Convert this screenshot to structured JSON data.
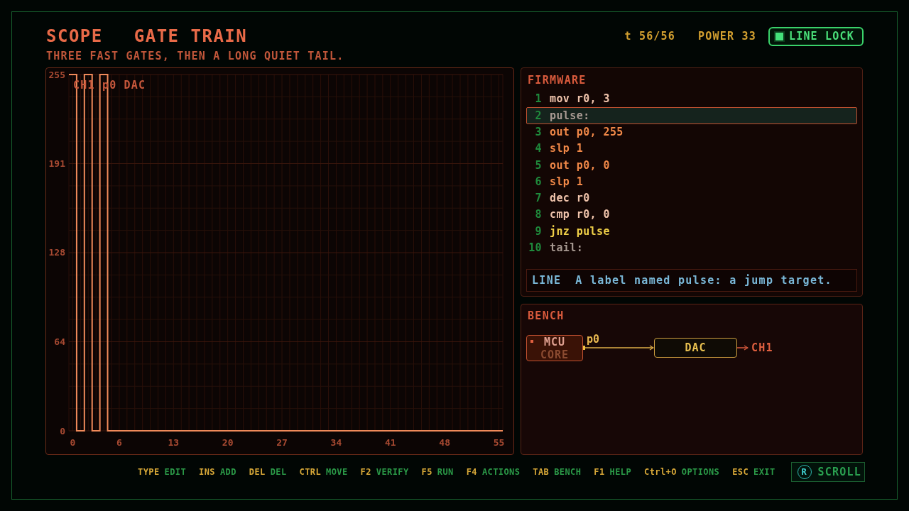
{
  "header": {
    "mode": "SCOPE",
    "title": "GATE TRAIN",
    "subtitle": "THREE FAST GATES, THEN A LONG QUIET TAIL."
  },
  "status": {
    "tick": "t 56/56",
    "power": "POWER 33",
    "line_lock": {
      "label": "LINE LOCK",
      "on": true
    }
  },
  "scope": {
    "chart_data": {
      "type": "line",
      "title": "CH1 p0 DAC",
      "x": [
        -0.5,
        0.5,
        0.5,
        1.5,
        1.5,
        2.5,
        2.5,
        3.5,
        3.5,
        4.5,
        4.5,
        55.5
      ],
      "series": [
        {
          "color": "#f08a5a",
          "values": [
            255,
            255,
            0,
            0,
            255,
            255,
            0,
            0,
            255,
            255,
            0,
            0
          ]
        }
      ],
      "xlim": [
        -0.5,
        55.5
      ],
      "ylim": [
        0,
        255
      ],
      "xticks": [
        0,
        6,
        13,
        20,
        27,
        34,
        41,
        48,
        55
      ],
      "yticks": [
        0,
        64,
        128,
        191,
        255
      ],
      "grid": true
    }
  },
  "firmware": {
    "title": "FIRMWARE",
    "lines": [
      {
        "number": "1",
        "code": "mov r0, 3",
        "kind": "op",
        "selected": false
      },
      {
        "number": "2",
        "code": "pulse:",
        "kind": "label",
        "selected": true
      },
      {
        "number": "3",
        "code": "out p0, 255",
        "kind": "io",
        "selected": false
      },
      {
        "number": "4",
        "code": "slp 1",
        "kind": "io",
        "selected": false
      },
      {
        "number": "5",
        "code": "out p0, 0",
        "kind": "io",
        "selected": false
      },
      {
        "number": "6",
        "code": "slp 1",
        "kind": "io",
        "selected": false
      },
      {
        "number": "7",
        "code": "dec r0",
        "kind": "op",
        "selected": false
      },
      {
        "number": "8",
        "code": "cmp r0, 0",
        "kind": "op",
        "selected": false
      },
      {
        "number": "9",
        "code": "jnz pulse",
        "kind": "jump",
        "selected": false
      },
      {
        "number": "10",
        "code": "tail:",
        "kind": "label",
        "selected": false
      }
    ],
    "info": {
      "label": "LINE",
      "text": "A label named pulse: a jump target."
    }
  },
  "bench": {
    "title": "BENCH",
    "source": {
      "name": "MCU",
      "detail": "CORE",
      "port": "p0"
    },
    "device": {
      "name": "DAC"
    },
    "output": "CH1"
  },
  "footer": {
    "hints": [
      {
        "key": "TYPE",
        "action": "EDIT"
      },
      {
        "key": "INS",
        "action": "ADD"
      },
      {
        "key": "DEL",
        "action": "DEL"
      },
      {
        "key": "CTRL",
        "action": "MOVE"
      },
      {
        "key": "F2",
        "action": "VERIFY"
      },
      {
        "key": "F5",
        "action": "RUN"
      },
      {
        "key": "F4",
        "action": "ACTIONS"
      },
      {
        "key": "TAB",
        "action": "BENCH"
      },
      {
        "key": "F1",
        "action": "HELP"
      },
      {
        "key": "Ctrl+O",
        "action": "OPTIONS"
      },
      {
        "key": "ESC",
        "action": "EXIT"
      }
    ],
    "scroll_button": {
      "key": "R",
      "label": "SCROLL"
    }
  }
}
